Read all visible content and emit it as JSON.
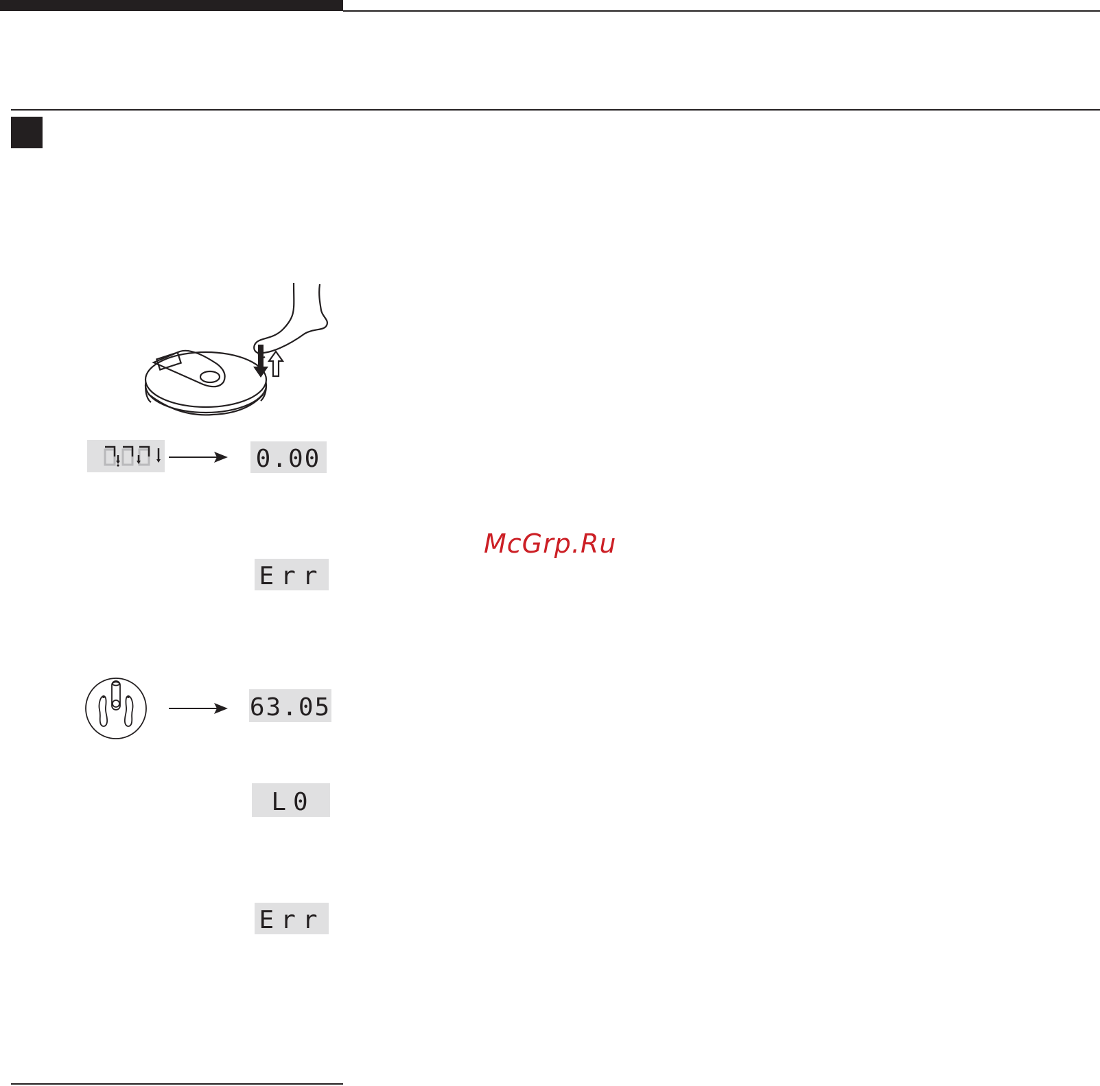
{
  "watermark": {
    "text": "McGrp.Ru",
    "color": "#cc1f25"
  },
  "displays": {
    "startup_segments": {
      "text": "",
      "state": "all-segments-test"
    },
    "zero": {
      "text": "0.00"
    },
    "error_1": {
      "text": "Err"
    },
    "weight": {
      "text": "63.05"
    },
    "low_battery": {
      "text": "L0"
    },
    "error_2": {
      "text": "Err"
    }
  },
  "icons": {
    "scale_tap": "foot-tapping-scale-icon",
    "step_on": "feet-on-scale-icon",
    "arrow": "right-arrow-icon"
  },
  "colors": {
    "ink": "#231f20",
    "lcd_background": "#e0e0e1",
    "lcd_dim_segment": "#b9b9bb"
  }
}
